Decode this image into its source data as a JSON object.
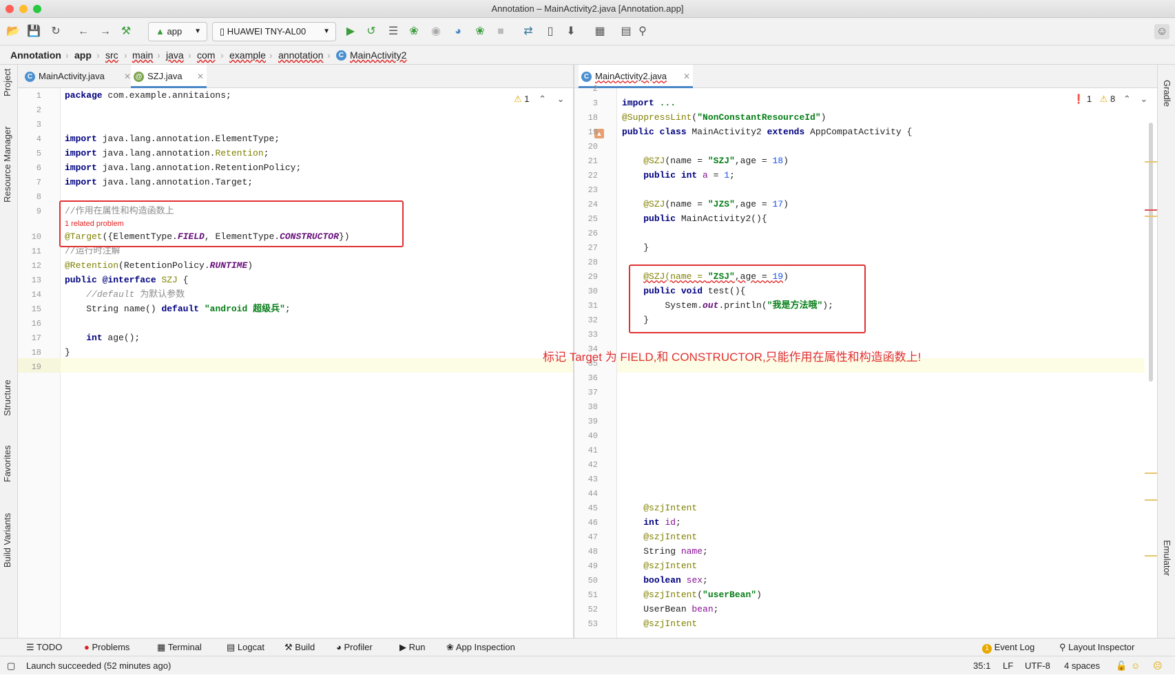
{
  "window": {
    "title": "Annotation – MainActivity2.java [Annotation.app]"
  },
  "toolbar": {
    "config": "app",
    "device": "HUAWEI TNY-AL00",
    "icons": [
      "open-icon",
      "save-icon",
      "sync-icon",
      "back-icon",
      "forward-icon",
      "build-hammer-icon",
      "run-icon",
      "apply-changes-icon",
      "coverage-icon",
      "debug-icon",
      "attach-icon",
      "profile-icon",
      "attach-debugger-icon",
      "stop-icon",
      "sync-gradle-icon",
      "avd-manager-icon",
      "sdk-manager-icon",
      "project-structure-icon",
      "layout-icon",
      "search-icon"
    ]
  },
  "breadcrumb": [
    "Annotation",
    "app",
    "src",
    "main",
    "java",
    "com",
    "example",
    "annotation",
    "MainActivity2"
  ],
  "left_strip": [
    "Project",
    "Resource Manager",
    "Structure",
    "Favorites",
    "Build Variants"
  ],
  "right_strip": [
    "Gradle",
    "Emulator"
  ],
  "left_editor": {
    "tabs": [
      {
        "label": "MainActivity.java",
        "icon": "C"
      },
      {
        "label": "SZJ.java",
        "icon": "@"
      }
    ],
    "warnings": "1",
    "lines": [
      {
        "n": "1",
        "html": "<span class=\"kw\">package</span> com.example.annitaions;"
      },
      {
        "n": "2",
        "html": ""
      },
      {
        "n": "3",
        "html": ""
      },
      {
        "n": "4",
        "html": "<span class=\"kw\">import</span> java.lang.annotation.ElementType;"
      },
      {
        "n": "5",
        "html": "<span class=\"kw\">import</span> java.lang.annotation.<span class=\"an\">Retention</span>;"
      },
      {
        "n": "6",
        "html": "<span class=\"kw\">import</span> java.lang.annotation.RetentionPolicy;"
      },
      {
        "n": "7",
        "html": "<span class=\"kw\">import</span> java.lang.annotation.Target;"
      },
      {
        "n": "8",
        "html": ""
      },
      {
        "n": "9",
        "html": "<span class=\"cm\">//作用在属性和构造函数上</span>"
      },
      {
        "n": "",
        "html": "<span style=\"color:#e02020;font-family:'Liberation Sans',sans-serif;font-size:11px\">1 related problem</span>"
      },
      {
        "n": "10",
        "html": "<span class=\"an\">@Target</span>({ElementType.<span class=\"it\">FIELD</span>, ElementType.<span class=\"it\">CONSTRUCTOR</span>})"
      },
      {
        "n": "11",
        "html": "<span class=\"cm\">//运行时注解</span>"
      },
      {
        "n": "12",
        "html": "<span class=\"an\">@Retention</span>(RetentionPolicy.<span class=\"it\">RUNTIME</span>)"
      },
      {
        "n": "13",
        "html": "<span class=\"kw\">public @interface</span> <span class=\"an\">SZJ</span> {"
      },
      {
        "n": "14",
        "html": "    <span class=\"cm\"><i>//default</i> 为默认参数</span>"
      },
      {
        "n": "15",
        "html": "    String name() <span class=\"kw\">default</span> <span class=\"st\">\"android 超级兵\"</span>;"
      },
      {
        "n": "16",
        "html": ""
      },
      {
        "n": "17",
        "html": "    <span class=\"kw\">int</span> age();"
      },
      {
        "n": "18",
        "html": "}"
      },
      {
        "n": "19",
        "html": ""
      }
    ]
  },
  "right_editor": {
    "tabs": [
      {
        "label": "MainActivity2.java",
        "icon": "C"
      }
    ],
    "errors": "1",
    "warnings": "8",
    "lines": [
      {
        "n": "2",
        "html": ""
      },
      {
        "n": "3",
        "html": "<span class=\"kw\">import</span> <span class=\"st\">...</span>"
      },
      {
        "n": "18",
        "html": "<span class=\"an\">@SuppressLint</span>(<span class=\"st\">\"NonConstantResourceId\"</span>)"
      },
      {
        "n": "19",
        "html": "<span class=\"kw\">public class</span> MainActivity2 <span class=\"kw\">extends</span> AppCompatActivity {"
      },
      {
        "n": "20",
        "html": ""
      },
      {
        "n": "21",
        "html": "    <span class=\"an\">@SZJ</span>(name = <span class=\"st\">\"SZJ\"</span>,age = <span class=\"nm\">18</span>)"
      },
      {
        "n": "22",
        "html": "    <span class=\"kw\">public int</span> <span class=\"fld\">a</span> = <span class=\"nm\">1</span>;"
      },
      {
        "n": "23",
        "html": ""
      },
      {
        "n": "24",
        "html": "    <span class=\"an\">@SZJ</span>(name = <span class=\"st\">\"JZS\"</span>,age = <span class=\"nm\">17</span>)"
      },
      {
        "n": "25",
        "html": "    <span class=\"kw\">public</span> MainActivity2(){"
      },
      {
        "n": "26",
        "html": ""
      },
      {
        "n": "27",
        "html": "    }"
      },
      {
        "n": "28",
        "html": ""
      },
      {
        "n": "29",
        "html": "    <span class=\"an\" style=\"text-decoration:underline wavy #e02020\">@SZJ(name = </span><span class=\"st\" style=\"text-decoration:underline wavy #e02020\">\"ZSJ\"</span><span style=\"text-decoration:underline wavy #e02020\">,age = </span><span class=\"nm\" style=\"text-decoration:underline wavy #e02020\">19</span>)"
      },
      {
        "n": "30",
        "html": "    <span class=\"kw\">public void</span> test(){"
      },
      {
        "n": "31",
        "html": "        System.<span class=\"it\">out</span>.println(<span class=\"st\">\"我是方法哦\"</span>);"
      },
      {
        "n": "32",
        "html": "    }"
      },
      {
        "n": "33",
        "html": ""
      },
      {
        "n": "34",
        "html": ""
      },
      {
        "n": "35",
        "html": ""
      },
      {
        "n": "36",
        "html": ""
      },
      {
        "n": "37",
        "html": ""
      },
      {
        "n": "38",
        "html": ""
      },
      {
        "n": "39",
        "html": ""
      },
      {
        "n": "40",
        "html": ""
      },
      {
        "n": "41",
        "html": ""
      },
      {
        "n": "42",
        "html": ""
      },
      {
        "n": "43",
        "html": ""
      },
      {
        "n": "44",
        "html": ""
      },
      {
        "n": "45",
        "html": "    <span class=\"an\">@szjIntent</span>"
      },
      {
        "n": "46",
        "html": "    <span class=\"kw\">int</span> <span class=\"fld\">id</span>;"
      },
      {
        "n": "47",
        "html": "    <span class=\"an\">@szjIntent</span>"
      },
      {
        "n": "48",
        "html": "    String <span class=\"fld\">name</span>;"
      },
      {
        "n": "49",
        "html": "    <span class=\"an\">@szjIntent</span>"
      },
      {
        "n": "50",
        "html": "    <span class=\"kw\">boolean</span> <span class=\"fld\">sex</span>;"
      },
      {
        "n": "51",
        "html": "    <span class=\"an\">@szjIntent</span>(<span class=\"st\">\"userBean\"</span>)"
      },
      {
        "n": "52",
        "html": "    UserBean <span class=\"fld\">bean</span>;"
      },
      {
        "n": "53",
        "html": "    <span class=\"an\">@szjIntent</span>"
      }
    ]
  },
  "annotation_text": "标记 Target 为 FIELD,和 CONSTRUCTOR,只能作用在属性和构造函数上!",
  "bottom_tools": [
    "TODO",
    "Problems",
    "Terminal",
    "Logcat",
    "Build",
    "Profiler",
    "Run",
    "App Inspection"
  ],
  "bottom_right_tools": [
    "Event Log",
    "Layout Inspector"
  ],
  "event_log_count": "1",
  "status": {
    "message": "Launch succeeded (52 minutes ago)",
    "position": "35:1",
    "line_sep": "LF",
    "encoding": "UTF-8",
    "indent": "4 spaces"
  },
  "colors": {
    "accent": "#4a88c7",
    "annotation_red": "#e03030",
    "error": "#e02020",
    "warning": "#e8c46a"
  }
}
